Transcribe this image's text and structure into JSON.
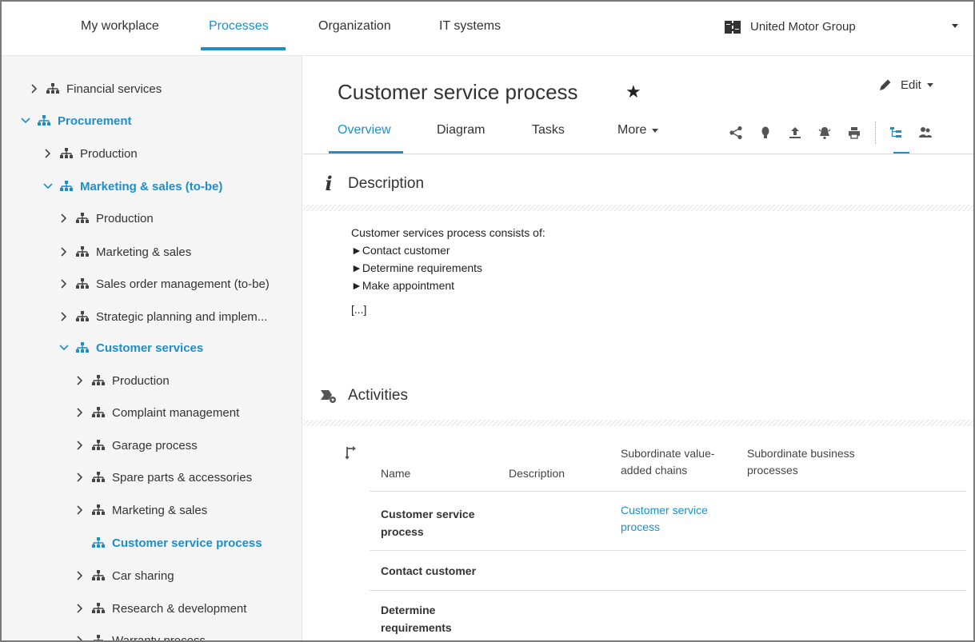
{
  "topnav": {
    "tabs": [
      {
        "label": "My workplace"
      },
      {
        "label": "Processes"
      },
      {
        "label": "Organization"
      },
      {
        "label": "IT systems"
      }
    ],
    "database": "United Motor Group"
  },
  "sidebar": {
    "items": [
      {
        "label": "Financial services"
      },
      {
        "label": "Procurement"
      },
      {
        "label": "Production"
      },
      {
        "label": "Marketing & sales (to-be)"
      },
      {
        "label": "Production"
      },
      {
        "label": "Marketing & sales"
      },
      {
        "label": "Sales order management (to-be)"
      },
      {
        "label": "Strategic planning and implem..."
      },
      {
        "label": "Customer services"
      },
      {
        "label": "Production"
      },
      {
        "label": "Complaint management"
      },
      {
        "label": "Garage process"
      },
      {
        "label": "Spare parts & accessories"
      },
      {
        "label": "Marketing & sales"
      },
      {
        "label": "Customer service process"
      },
      {
        "label": "Car sharing"
      },
      {
        "label": "Research & development"
      },
      {
        "label": "Warranty process"
      }
    ]
  },
  "main": {
    "title": "Customer service process",
    "edit_label": "Edit",
    "tabs": [
      {
        "label": "Overview"
      },
      {
        "label": "Diagram"
      },
      {
        "label": "Tasks"
      },
      {
        "label": "More"
      }
    ],
    "description": {
      "heading": "Description",
      "intro": "Customer services process consists of:",
      "bullets": [
        "Contact customer",
        "Determine requirements",
        "Make appointment"
      ],
      "ellipsis": "[...]"
    },
    "activities": {
      "heading": "Activities",
      "columns": [
        {
          "label": "Name"
        },
        {
          "label": "Description"
        },
        {
          "label": "Subordinate value-added chains",
          "line1": "Subordinate value-",
          "line2": "added chains"
        },
        {
          "label": "Subordinate business processes",
          "line1": "Subordinate business",
          "line2": "processes"
        }
      ],
      "rows": [
        {
          "name_line1": "Customer service",
          "name_line2": "process",
          "chain_line1": "Customer service",
          "chain_line2": "process"
        },
        {
          "name_line1": "Contact customer",
          "name_line2": "",
          "chain_line1": "",
          "chain_line2": ""
        },
        {
          "name_line1": "Determine",
          "name_line2": "requirements",
          "chain_line1": "",
          "chain_line2": ""
        }
      ]
    }
  },
  "colors": {
    "accent": "#1a8fcf",
    "sidebar_bg": "#f5f5f5",
    "text": "#333333"
  }
}
